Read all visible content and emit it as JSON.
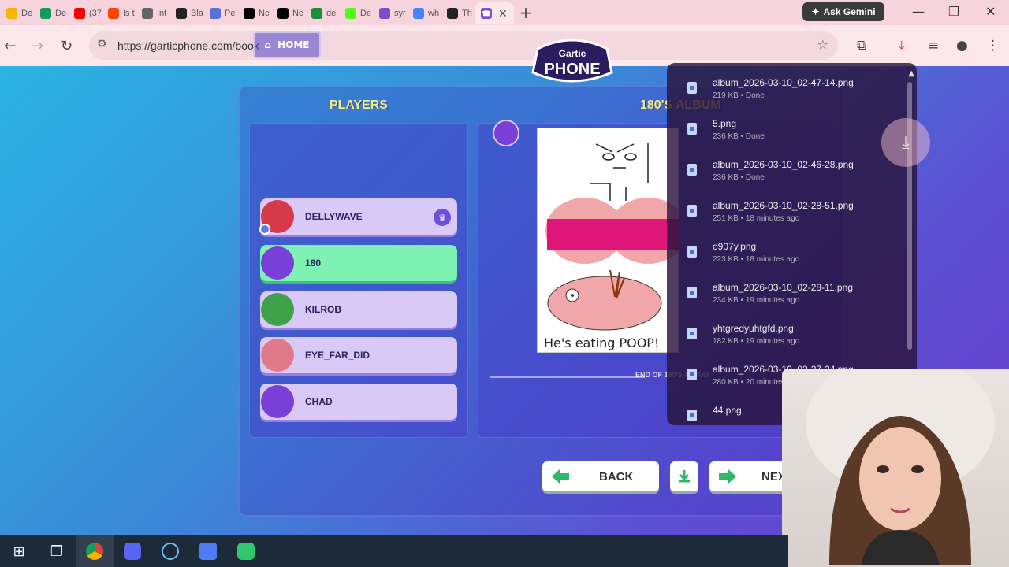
{
  "browser": {
    "tabs": [
      {
        "label": "De",
        "icon": "google-drive-icon",
        "color": "#f4b400"
      },
      {
        "label": "De",
        "icon": "google-drive-icon",
        "color": "#0f9d58"
      },
      {
        "label": "(37",
        "icon": "youtube-icon",
        "color": "#ff0000"
      },
      {
        "label": "Is t",
        "icon": "reddit-icon",
        "color": "#ff4500"
      },
      {
        "label": "Int",
        "icon": "globe-icon",
        "color": "#666666"
      },
      {
        "label": "Bla",
        "icon": "wix-icon",
        "color": "#222222"
      },
      {
        "label": "Pe",
        "icon": "imdb-icon",
        "color": "#5a6fd8"
      },
      {
        "label": "Nc",
        "icon": "x-icon",
        "color": "#000000"
      },
      {
        "label": "Nc",
        "icon": "x-icon",
        "color": "#000000"
      },
      {
        "label": "de",
        "icon": "green-app-icon",
        "color": "#1b8f3a"
      },
      {
        "label": "De",
        "icon": "kick-icon",
        "color": "#53fc18"
      },
      {
        "label": "syr",
        "icon": "peace-icon",
        "color": "#7b4fc9"
      },
      {
        "label": "wh",
        "icon": "google-icon",
        "color": "#4285f4"
      },
      {
        "label": "Th",
        "icon": "terminal-icon",
        "color": "#222222"
      }
    ],
    "active_tab_icon": "gartic-phone-icon",
    "new_tab": "+",
    "ask_gemini": "Ask Gemini",
    "url": "https://garticphone.com/book",
    "window_controls": {
      "minimize": "—",
      "restore": "❐",
      "close": "✕"
    }
  },
  "page": {
    "home_label": "HOME",
    "logo_top": "Gartic",
    "logo_bottom": "PHONE",
    "players_title": "PLAYERS",
    "album_title": "180'S ALBUM",
    "players": [
      {
        "name": "DELLYWAVE",
        "avatar_color": "#d63a4a",
        "host": true,
        "active": false
      },
      {
        "name": "180",
        "avatar_color": "#7a3fd6",
        "host": false,
        "active": true
      },
      {
        "name": "KILROB",
        "avatar_color": "#3fa24a",
        "host": false,
        "active": false
      },
      {
        "name": "EYE_FAR_DID",
        "avatar_color": "#e07a8a",
        "host": false,
        "active": false
      },
      {
        "name": "CHAD",
        "avatar_color": "#7a3fd6",
        "host": false,
        "active": false
      }
    ],
    "drawing_caption": "He's eating POOP!",
    "end_of_album": "END OF 180'S ALBUM",
    "back_label": "BACK",
    "next_label": "NEXT"
  },
  "downloads": [
    {
      "name": "album_2026-03-10_02-47-14.png",
      "meta": "219 KB • Done"
    },
    {
      "name": "5.png",
      "meta": "236 KB • Done"
    },
    {
      "name": "album_2026-03-10_02-46-28.png",
      "meta": "236 KB • Done"
    },
    {
      "name": "album_2026-03-10_02-28-51.png",
      "meta": "251 KB • 18 minutes ago"
    },
    {
      "name": "o907y.png",
      "meta": "223 KB • 18 minutes ago"
    },
    {
      "name": "album_2026-03-10_02-28-11.png",
      "meta": "234 KB • 19 minutes ago"
    },
    {
      "name": "yhtgredyuhtgfd.png",
      "meta": "182 KB • 19 minutes ago"
    },
    {
      "name": "album_2026-03-10_02-27-34.png",
      "meta": "280 KB • 20 minutes ago"
    },
    {
      "name": "44.png",
      "meta": ""
    }
  ],
  "taskbar": {
    "icons": [
      "windows-start-icon",
      "task-view-icon",
      "chrome-icon",
      "discord-icon",
      "steam-icon",
      "roblox-icon",
      "app-icon"
    ]
  }
}
